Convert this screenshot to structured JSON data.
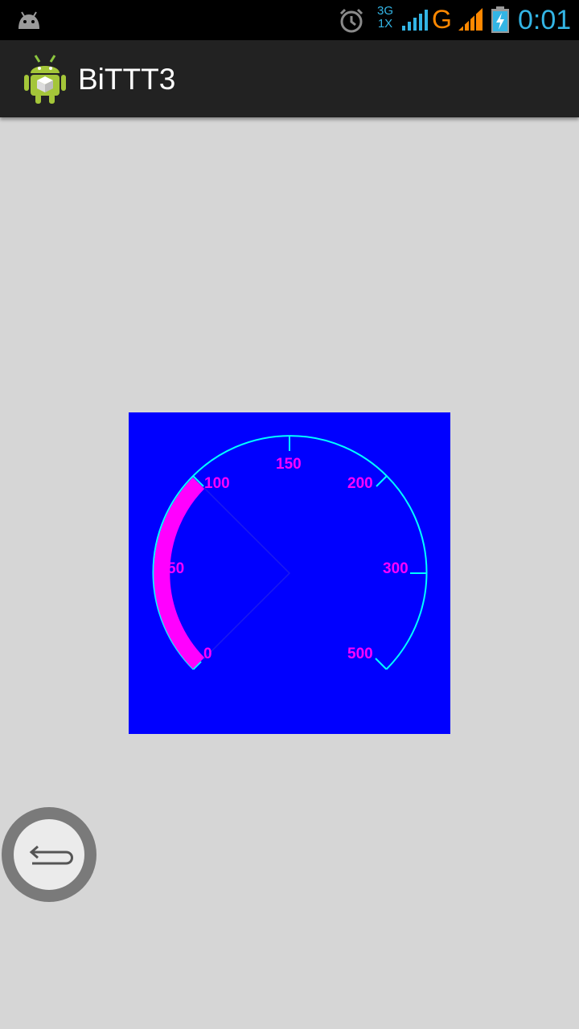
{
  "status_bar": {
    "network_type_top": "3G",
    "network_type_bottom": "1X",
    "data_label": "G",
    "time": "0:01",
    "icons": [
      "android-notification-icon",
      "alarm-icon",
      "signal-icon",
      "signal-icon",
      "battery-charging-icon"
    ]
  },
  "action_bar": {
    "title": "BiTTT3",
    "icon": "android-app-icon"
  },
  "gauge": {
    "colors": {
      "background": "#0000ff",
      "scale": "#00ffff",
      "progress": "#ff00ff",
      "labels": "#ff00ff"
    },
    "labels": [
      "0",
      "50",
      "100",
      "150",
      "200",
      "300",
      "500"
    ],
    "value_label": "100",
    "needle_at_label": "100"
  },
  "back_button": {
    "icon": "back-arrow-icon"
  }
}
